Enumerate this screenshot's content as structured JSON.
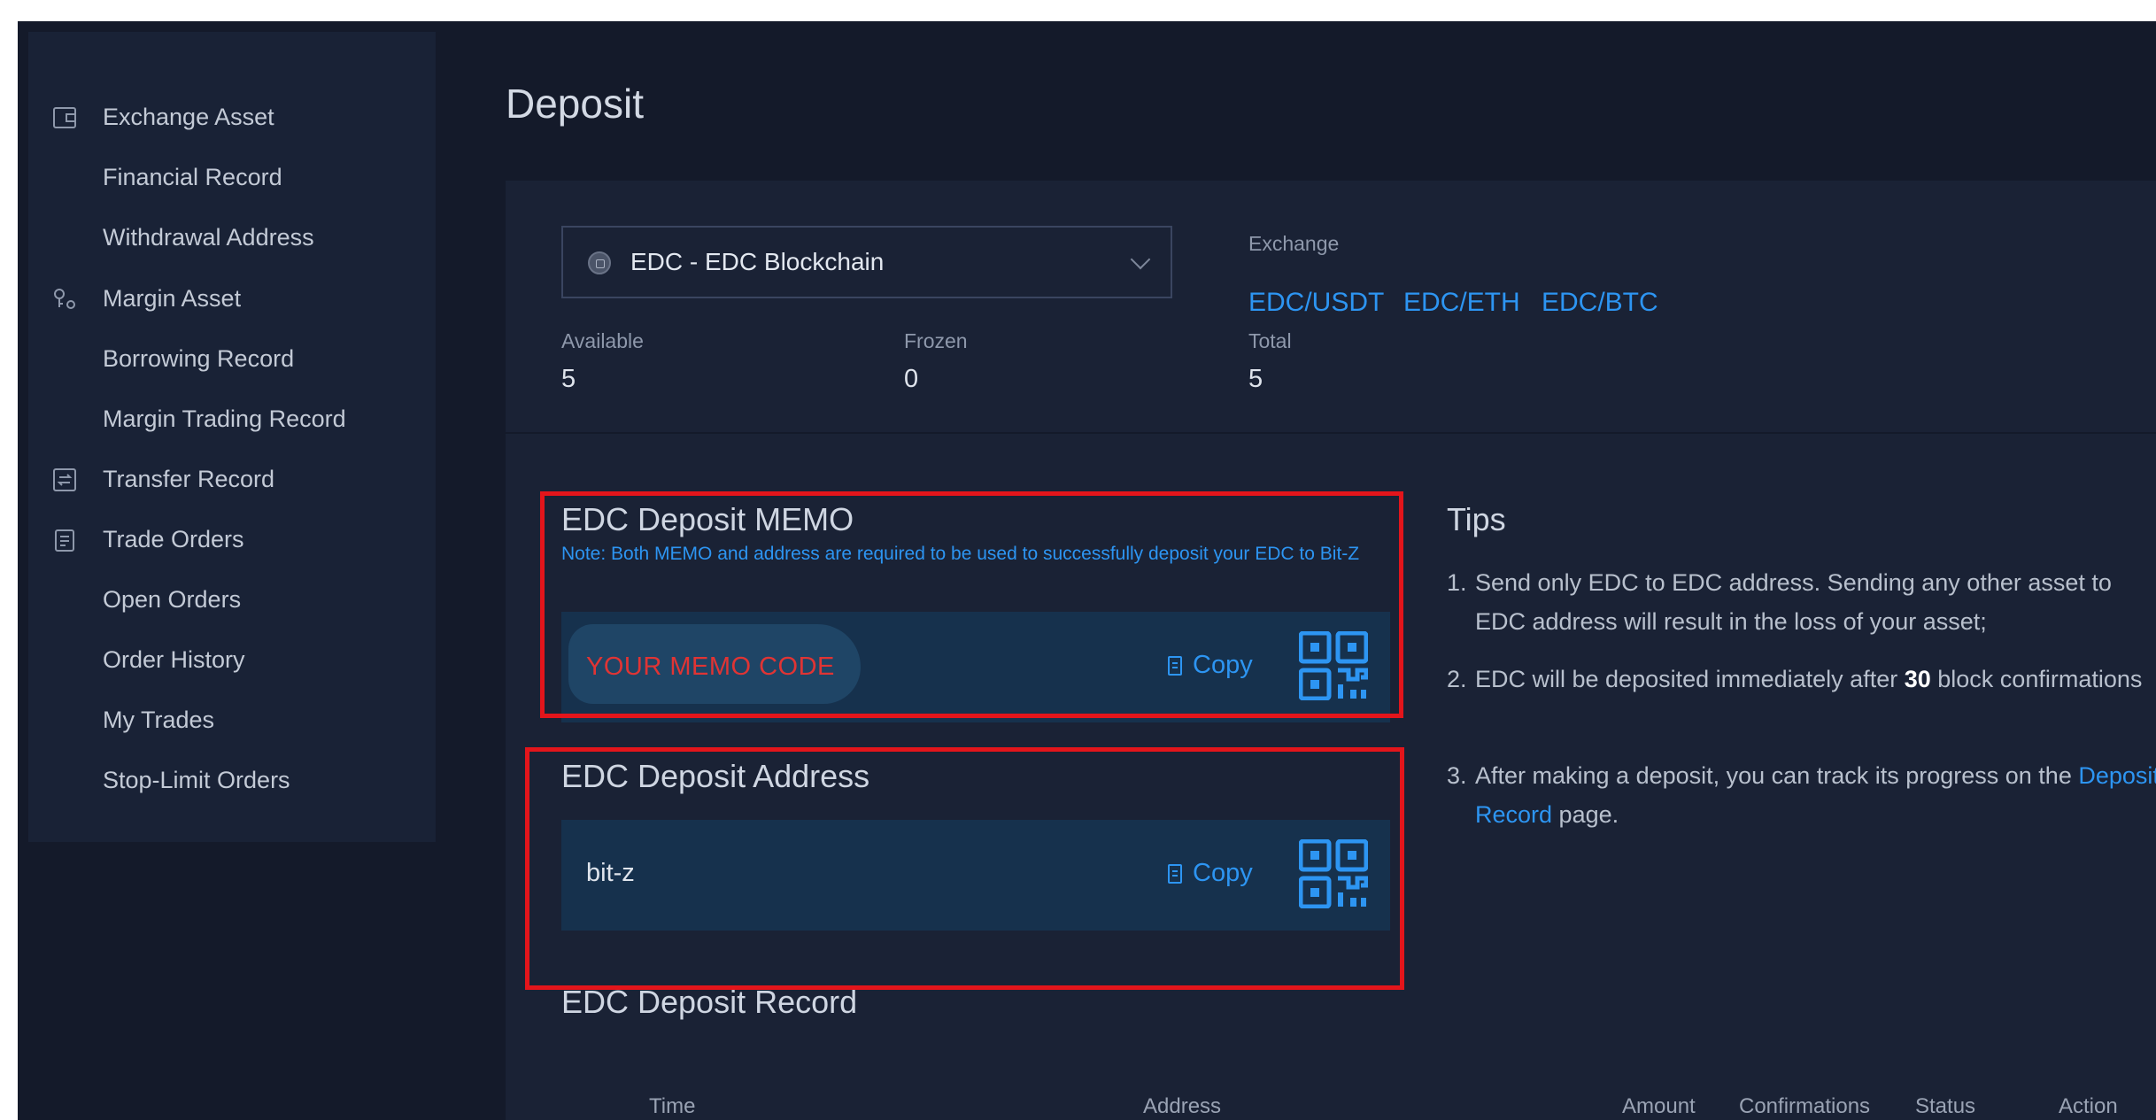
{
  "sidebar": {
    "items": [
      {
        "label": "Exchange Asset",
        "icon": "wallet-icon"
      },
      {
        "label": "Financial Record",
        "icon": ""
      },
      {
        "label": "Withdrawal Address",
        "icon": ""
      },
      {
        "label": "Margin Asset",
        "icon": "margin-key-icon"
      },
      {
        "label": "Borrowing Record",
        "icon": ""
      },
      {
        "label": "Margin Trading Record",
        "icon": ""
      },
      {
        "label": "Transfer Record",
        "icon": "transfer-icon"
      },
      {
        "label": "Trade Orders",
        "icon": "clipboard-icon"
      },
      {
        "label": "Open Orders",
        "icon": ""
      },
      {
        "label": "Order History",
        "icon": ""
      },
      {
        "label": "My Trades",
        "icon": ""
      },
      {
        "label": "Stop-Limit Orders",
        "icon": ""
      }
    ]
  },
  "page": {
    "title": "Deposit"
  },
  "currency": {
    "selected": "EDC - EDC Blockchain",
    "exchange_label": "Exchange",
    "pairs": [
      "EDC/USDT",
      "EDC/ETH",
      "EDC/BTC"
    ]
  },
  "balances": {
    "available_label": "Available",
    "available": "5",
    "frozen_label": "Frozen",
    "frozen": "0",
    "total_label": "Total",
    "total": "5"
  },
  "memo": {
    "title": "EDC Deposit MEMO",
    "note": "Note: Both MEMO and address are required to be used to successfully deposit your EDC to Bit-Z",
    "value": "YOUR MEMO CODE",
    "copy_label": "Copy"
  },
  "address": {
    "title": "EDC Deposit Address",
    "value": "bit-z",
    "copy_label": "Copy"
  },
  "tips": {
    "title": "Tips",
    "items": [
      {
        "num": "1.",
        "text": "Send only EDC to EDC address. Sending any other asset to EDC address will result in the loss of your asset;"
      },
      {
        "num": "2.",
        "pre": "EDC will be deposited immediately after ",
        "bold": "30",
        "post": " block confirmations"
      },
      {
        "num": "3.",
        "pre": "After making a deposit, you can track its progress on the ",
        "link": "Deposit Record",
        "post": " page."
      }
    ]
  },
  "record": {
    "title": "EDC Deposit Record",
    "columns": [
      "Time",
      "Address",
      "Amount",
      "Confirmations",
      "Status",
      "Action"
    ]
  },
  "colors": {
    "background": "#141a2a",
    "panel": "#1a2235",
    "accent_link": "#2d95f2",
    "highlight_box": "#e3151b",
    "memo_text": "#e03434"
  }
}
